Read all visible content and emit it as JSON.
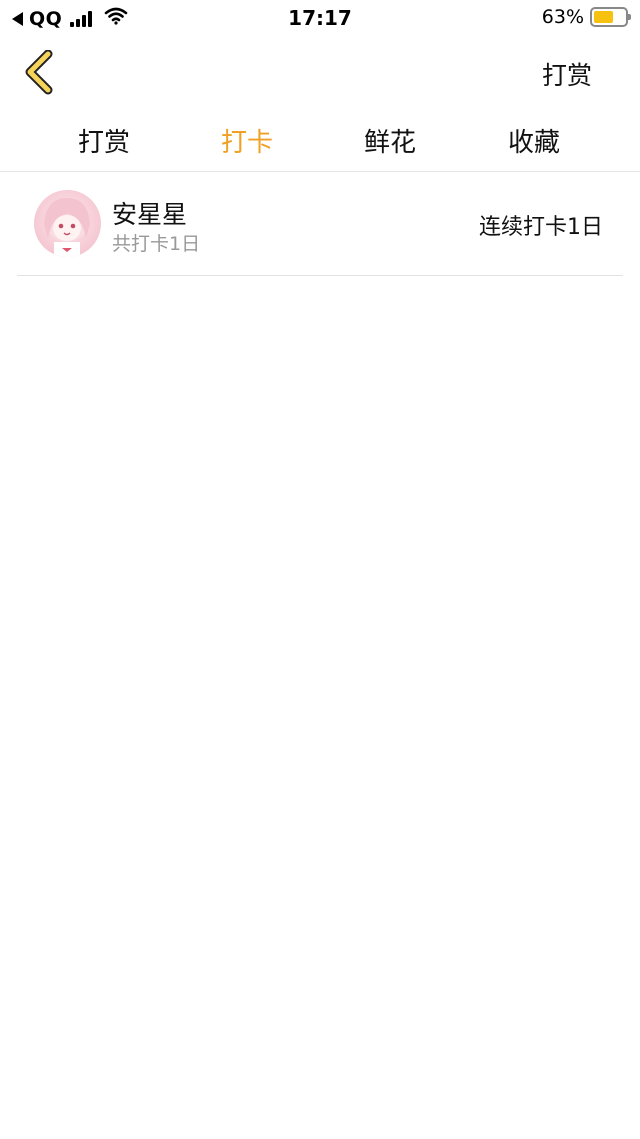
{
  "status_bar": {
    "carrier": "QQ",
    "time": "17:17",
    "battery": "63%",
    "battery_level": 0.63,
    "battery_color": "#f6c10f"
  },
  "nav": {
    "action_label": "打赏",
    "back_icon": "chevron-left-icon",
    "back_icon_color": "#f6d45a"
  },
  "tabs": [
    {
      "label": "打赏"
    },
    {
      "label": "打卡"
    },
    {
      "label": "鲜花"
    },
    {
      "label": "收藏"
    }
  ],
  "active_tab_color": "#f0a024",
  "list": [
    {
      "name": "安星星",
      "total": "共打卡1日",
      "streak": "连续打卡1日"
    }
  ]
}
